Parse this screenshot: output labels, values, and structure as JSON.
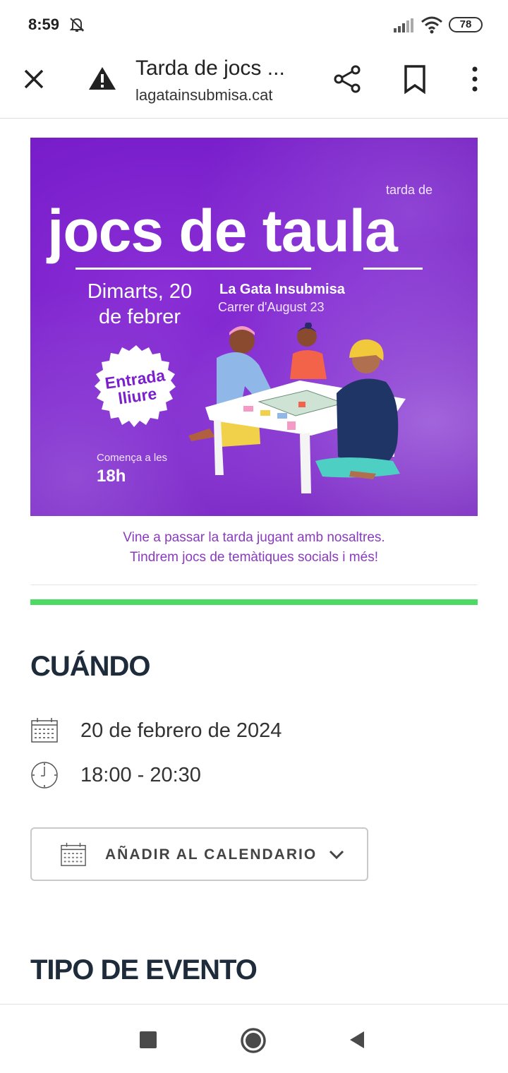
{
  "status_bar": {
    "time": "8:59",
    "battery": "78"
  },
  "toolbar": {
    "title": "Tarda de jocs ...",
    "url": "lagatainsubmisa.cat"
  },
  "poster": {
    "tarda_de": "tarda de",
    "title": "jocs de taula",
    "date_line1": "Dimarts, 20",
    "date_line2": "de febrer",
    "venue": "La Gata Insubmisa",
    "street": "Carrer d'August 23",
    "badge_line1": "Entrada",
    "badge_line2": "lliure",
    "start_label": "Comença a les",
    "start_hour": "18h",
    "colors": {
      "background": "#7a1fcc",
      "text": "#ffffff"
    }
  },
  "caption": {
    "line1": "Vine a passar la tarda jugant amb nosaltres.",
    "line2": "Tindrem jocs de temàtiques socials i més!"
  },
  "when": {
    "heading": "CUÁNDO",
    "date": "20 de febrero de 2024",
    "time": "18:00 - 20:30"
  },
  "calendar_button": {
    "label": "AÑADIR AL CALENDARIO"
  },
  "type_section": {
    "heading": "TIPO DE EVENTO"
  },
  "colors": {
    "accent_bar": "#4cd964",
    "heading": "#1e2b3a",
    "caption": "#8a3bbd"
  },
  "icons": {
    "status": [
      "bell-off-icon",
      "signal-icon",
      "wifi-icon",
      "battery-icon"
    ],
    "toolbar": [
      "close-icon",
      "warning-icon",
      "share-icon",
      "bookmark-icon",
      "more-vert-icon"
    ],
    "nav": [
      "recents-square-icon",
      "home-circle-icon",
      "back-triangle-icon"
    ]
  }
}
